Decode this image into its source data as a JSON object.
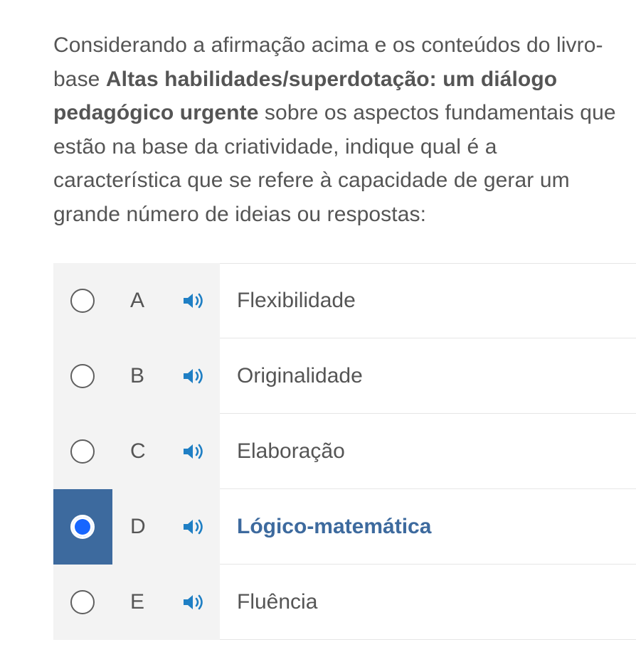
{
  "question": {
    "text_before": "Considerando a afirmação acima e os conteúdos do livro-base ",
    "book_title": "Altas habilidades/superdotação: um diálogo pedagógico urgente",
    "text_after": " sobre os aspectos fundamentais que estão na base da criatividade, indique qual é a característica que se refere à capacidade de gerar um grande número de ideias ou respostas:"
  },
  "options": [
    {
      "letter": "A",
      "label": "Flexibilidade",
      "selected": false
    },
    {
      "letter": "B",
      "label": "Originalidade",
      "selected": false
    },
    {
      "letter": "C",
      "label": "Elaboração",
      "selected": false
    },
    {
      "letter": "D",
      "label": "Lógico-matemática",
      "selected": true
    },
    {
      "letter": "E",
      "label": "Fluência",
      "selected": false
    }
  ],
  "colors": {
    "accent": "#3d6a9e",
    "speaker": "#1f7fc4",
    "radio_selected": "#1766ff"
  },
  "icons": {
    "speaker": "speaker-icon",
    "radio": "radio-icon"
  }
}
